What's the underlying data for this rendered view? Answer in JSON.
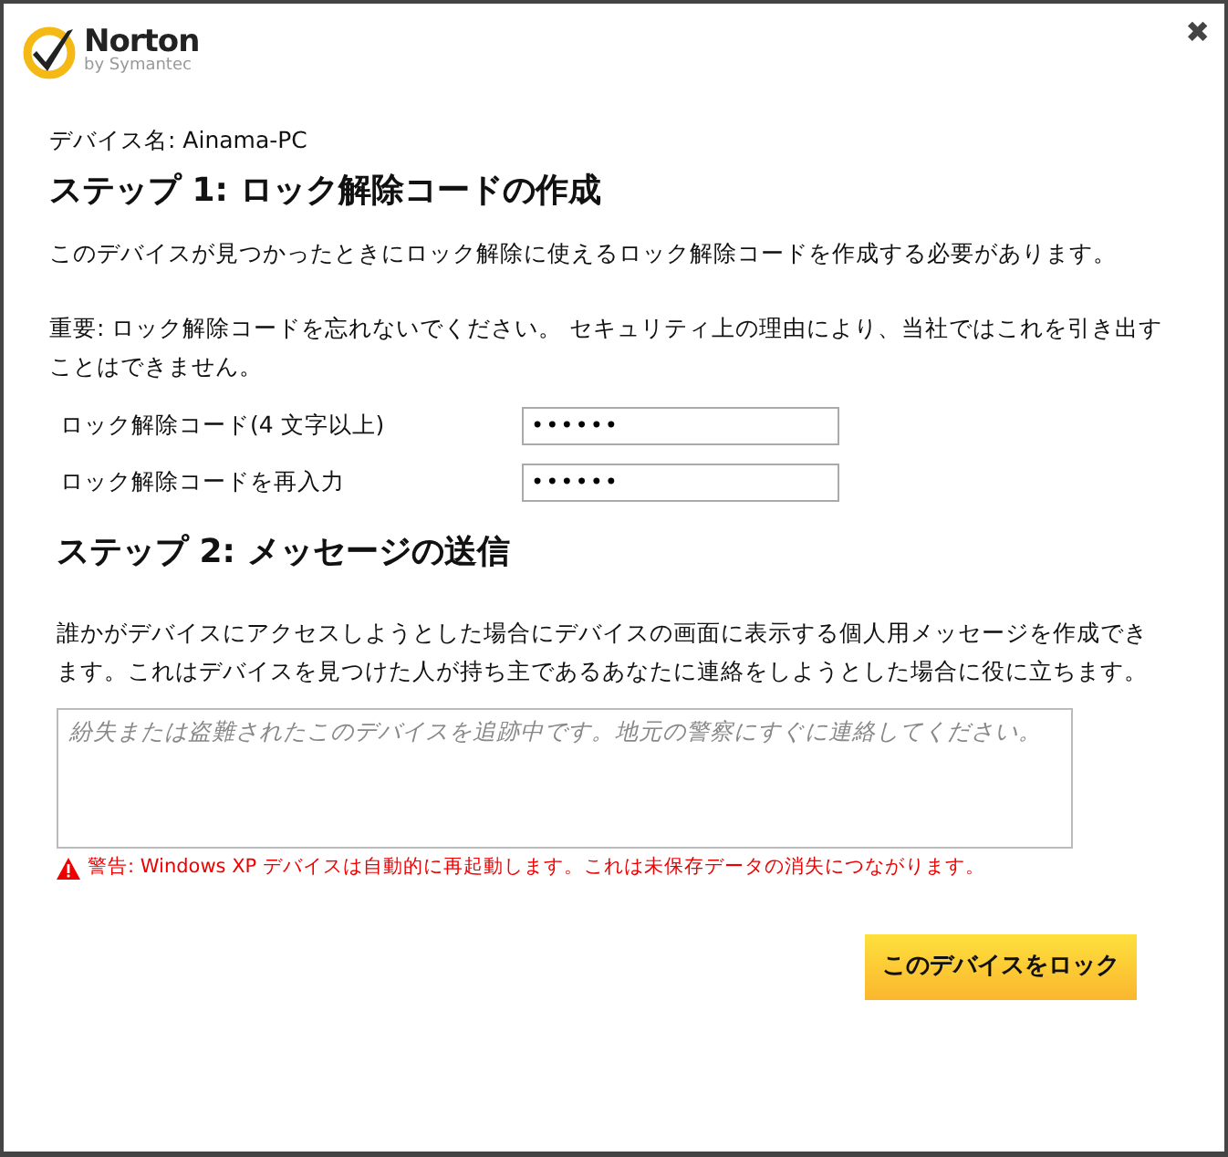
{
  "logo": {
    "brand": "Norton",
    "byline": "by Symantec"
  },
  "close": "✖",
  "device_name": "デバイス名: Ainama-PC",
  "step1": {
    "heading": "ステップ 1: ロック解除コードの作成",
    "paragraphs": [
      "このデバイスが見つかったときにロック解除に使えるロック解除コードを作成する必要があります。",
      "重要: ロック解除コードを忘れないでください。 セキュリティ上の理由により、当社ではこれを引き出すことはできません。"
    ],
    "fields": [
      {
        "label": "ロック解除コード(4 文字以上)",
        "value": "••••••"
      },
      {
        "label": "ロック解除コードを再入力",
        "value": "••••••"
      }
    ]
  },
  "step2": {
    "heading": "ステップ 2: メッセージの送信",
    "paragraph": "誰かがデバイスにアクセスしようとした場合にデバイスの画面に表示する個人用メッセージを作成できます。これはデバイスを見つけた人が持ち主であるあなたに連絡をしようとした場合に役に立ちます。",
    "message_placeholder": "紛失または盗難されたこのデバイスを追跡中です。地元の警察にすぐに連絡してください。",
    "warning": "警告: Windows XP デバイスは自動的に再起動します。これは未保存データの消失につながります。"
  },
  "button": "このデバイスをロック"
}
